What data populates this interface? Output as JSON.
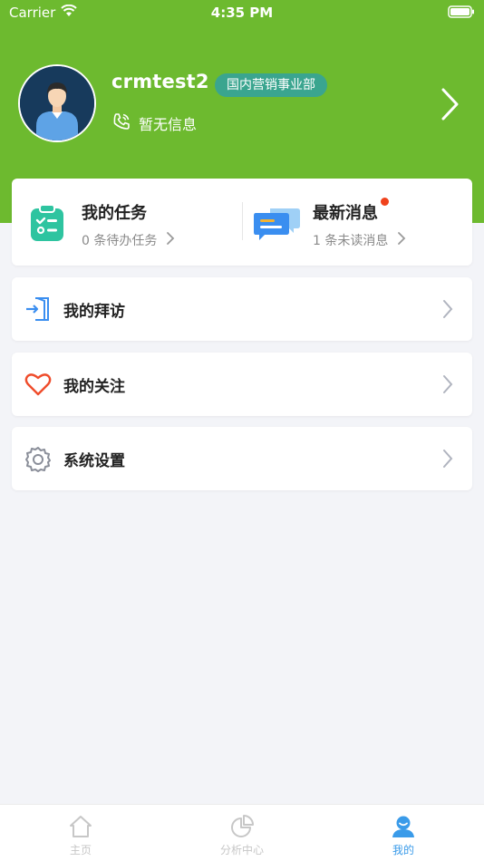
{
  "status_bar": {
    "carrier": "Carrier",
    "time": "4:35 PM"
  },
  "profile": {
    "username": "crmtest2",
    "department": "国内营销事业部",
    "phone_text": "暂无信息"
  },
  "stats": {
    "tasks": {
      "title": "我的任务",
      "subtitle": "0 条待办任务",
      "icon": "clipboard-check-icon"
    },
    "messages": {
      "title": "最新消息",
      "subtitle": "1 条未读消息",
      "icon": "chat-bubbles-icon",
      "has_unread_dot": true
    }
  },
  "menu": {
    "visits": {
      "label": "我的拜访",
      "icon": "sign-in-icon"
    },
    "follows": {
      "label": "我的关注",
      "icon": "heart-icon"
    },
    "settings": {
      "label": "系统设置",
      "icon": "gear-icon"
    }
  },
  "tabbar": {
    "home": {
      "label": "主页",
      "icon": "home-icon"
    },
    "analytics": {
      "label": "分析中心",
      "icon": "pie-chart-icon"
    },
    "mine": {
      "label": "我的",
      "icon": "user-icon",
      "active": true
    }
  },
  "colors": {
    "header_green": "#6dba2f",
    "badge_teal": "#3aa58f",
    "active_blue": "#3a9be9",
    "unread_red": "#f0421c"
  }
}
